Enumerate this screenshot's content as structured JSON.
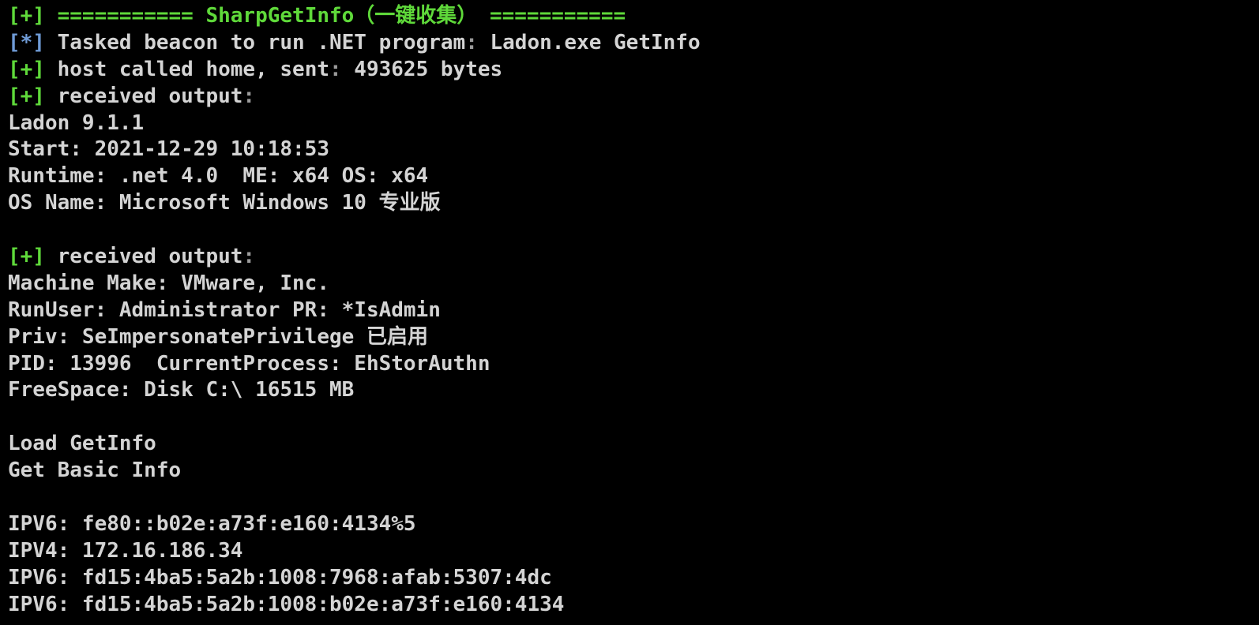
{
  "terminal": {
    "colors": {
      "background": "#000000",
      "text": "#d4d4d4",
      "success_marker": "#5fd93a",
      "info_marker": "#6f9bd6"
    },
    "lines": [
      {
        "type": "header",
        "marker": "[+]",
        "text": " =========== SharpGetInfo（一键收集） ==========="
      },
      {
        "type": "info",
        "marker": "[*]",
        "text": " Tasked beacon to run .NET program",
        "sep": ":",
        "rest": " Ladon.exe GetInfo"
      },
      {
        "type": "success",
        "marker": "[+]",
        "text": " host called home, sent",
        "sep": ":",
        "rest": " 493625 bytes"
      },
      {
        "type": "success",
        "marker": "[+]",
        "text": " received output",
        "sep": ":",
        "rest": ""
      },
      {
        "type": "output",
        "text": "Ladon 9.1.1"
      },
      {
        "type": "output",
        "text": "Start: 2021-12-29 10:18:53"
      },
      {
        "type": "output",
        "text": "Runtime: .net 4.0  ME: x64 OS: x64"
      },
      {
        "type": "output",
        "text": "OS Name: Microsoft Windows 10 专业版"
      },
      {
        "type": "blank",
        "text": ""
      },
      {
        "type": "success",
        "marker": "[+]",
        "text": " received output",
        "sep": ":",
        "rest": ""
      },
      {
        "type": "output",
        "text": "Machine Make: VMware, Inc."
      },
      {
        "type": "output",
        "text": "RunUser: Administrator PR: *IsAdmin"
      },
      {
        "type": "output",
        "text": "Priv: SeImpersonatePrivilege 已启用"
      },
      {
        "type": "output",
        "text": "PID: 13996  CurrentProcess: EhStorAuthn"
      },
      {
        "type": "output",
        "text": "FreeSpace: Disk C:\\ 16515 MB"
      },
      {
        "type": "blank",
        "text": ""
      },
      {
        "type": "output",
        "text": "Load GetInfo"
      },
      {
        "type": "output",
        "text": "Get Basic Info"
      },
      {
        "type": "blank",
        "text": ""
      },
      {
        "type": "output",
        "text": "IPV6: fe80::b02e:a73f:e160:4134%5"
      },
      {
        "type": "output",
        "text": "IPV4: 172.16.186.34"
      },
      {
        "type": "output",
        "text": "IPV6: fd15:4ba5:5a2b:1008:7968:afab:5307:4dc"
      },
      {
        "type": "output",
        "text": "IPV6: fd15:4ba5:5a2b:1008:b02e:a73f:e160:4134"
      }
    ]
  }
}
